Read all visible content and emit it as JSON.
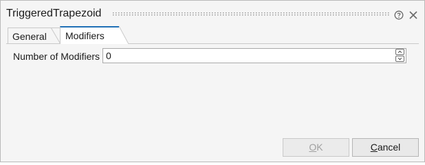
{
  "dialog": {
    "title": "TriggeredTrapezoid"
  },
  "icons": {
    "help": "help-icon",
    "close": "close-icon",
    "spin_up": "chevron-up-icon",
    "spin_down": "chevron-down-icon"
  },
  "tabs": [
    {
      "label": "General",
      "active": false
    },
    {
      "label": "Modifiers",
      "active": true
    }
  ],
  "modifiers": {
    "count_label": "Number of Modifiers",
    "count_value": "0"
  },
  "buttons": {
    "ok_mnemonic": "O",
    "ok_rest": "K",
    "ok_enabled": false,
    "cancel_mnemonic": "C",
    "cancel_rest": "ancel"
  },
  "colors": {
    "active_tab_accent": "#1f6fb5",
    "disabled_text": "#a0a0a0"
  }
}
